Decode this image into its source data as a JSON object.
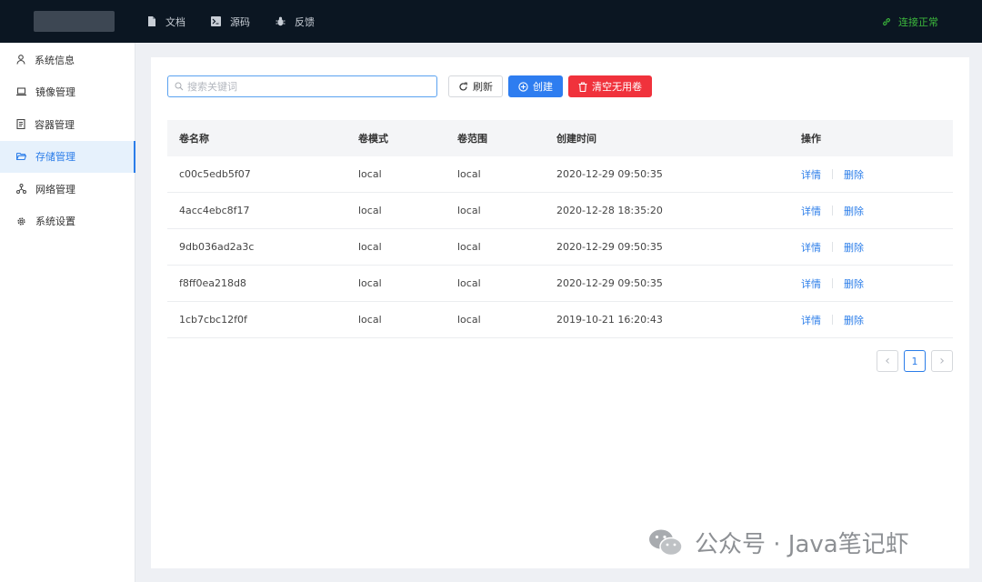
{
  "topbar": {
    "nav": [
      {
        "label": "文档",
        "icon": "document-icon"
      },
      {
        "label": "源码",
        "icon": "terminal-icon"
      },
      {
        "label": "反馈",
        "icon": "bug-icon"
      }
    ],
    "status": "连接正常",
    "status_color": "#3cb83c"
  },
  "sidebar": {
    "items": [
      {
        "label": "系统信息",
        "icon": "user-icon"
      },
      {
        "label": "镜像管理",
        "icon": "laptop-icon"
      },
      {
        "label": "容器管理",
        "icon": "file-icon"
      },
      {
        "label": "存储管理",
        "icon": "folder-open-icon",
        "active": true
      },
      {
        "label": "网络管理",
        "icon": "network-icon"
      },
      {
        "label": "系统设置",
        "icon": "gear-icon"
      }
    ]
  },
  "toolbar": {
    "search_placeholder": "搜索关键词",
    "refresh_label": "刷新",
    "create_label": "创建",
    "clear_label": "清空无用卷"
  },
  "table": {
    "headers": {
      "name": "卷名称",
      "mode": "卷模式",
      "scope": "卷范围",
      "time": "创建时间",
      "ops": "操作"
    },
    "rows": [
      {
        "name": "c00c5edb5f07",
        "mode": "local",
        "scope": "local",
        "time": "2020-12-29 09:50:35"
      },
      {
        "name": "4acc4ebc8f17",
        "mode": "local",
        "scope": "local",
        "time": "2020-12-28 18:35:20"
      },
      {
        "name": "9db036ad2a3c",
        "mode": "local",
        "scope": "local",
        "time": "2020-12-29 09:50:35"
      },
      {
        "name": "f8ff0ea218d8",
        "mode": "local",
        "scope": "local",
        "time": "2020-12-29 09:50:35"
      },
      {
        "name": "1cb7cbc12f0f",
        "mode": "local",
        "scope": "local",
        "time": "2019-10-21 16:20:43"
      }
    ],
    "detail_label": "详情",
    "delete_label": "删除"
  },
  "pagination": {
    "current_page": "1",
    "prev_symbol": "‹",
    "next_symbol": "›"
  },
  "colors": {
    "primary": "#2e7df0",
    "danger": "#f0323c",
    "topbar": "#0b1622"
  },
  "watermark": {
    "text": "公众号 · Java笔记虾"
  }
}
